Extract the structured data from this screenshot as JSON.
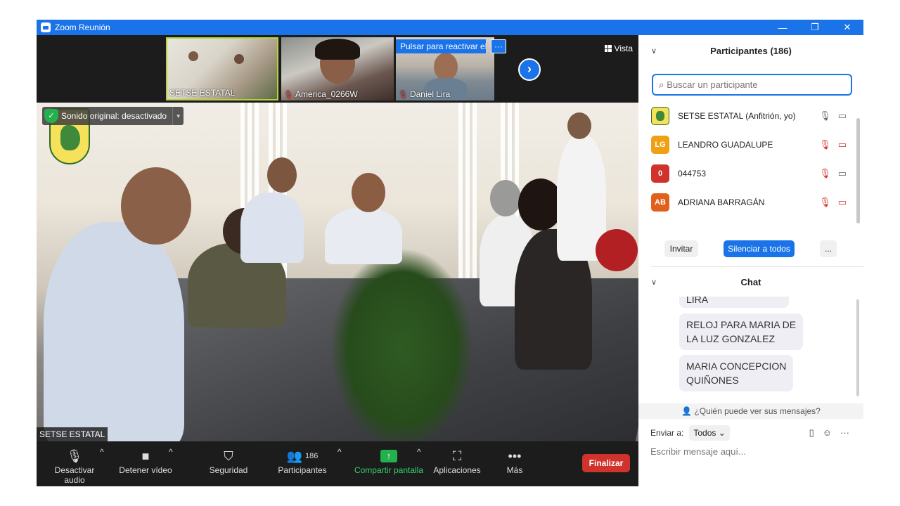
{
  "window": {
    "title": "Zoom Reunión",
    "minimize": "—",
    "restore": "❐",
    "close": "✕"
  },
  "strip": {
    "thumbs": [
      {
        "name": "SETSE ESTATAL"
      },
      {
        "name": "America_0266W"
      },
      {
        "name": "Daniel Lira"
      }
    ],
    "unmute_banner": "Pulsar para reactivar el audio",
    "banner_more": "···",
    "next_arrow": "›",
    "view_label": "Vista"
  },
  "main_video": {
    "sound_pill": "Sonido original: desactivado",
    "sound_dd": "▾",
    "name_tag": "SETSE ESTATAL"
  },
  "toolbar": {
    "mute": "Desactivar audio",
    "stop_video": "Detener vídeo",
    "security": "Seguridad",
    "participants": "Participantes",
    "participants_count": "186",
    "share": "Compartir pantalla",
    "apps": "Aplicaciones",
    "more": "Más",
    "end": "Finalizar",
    "caret": "^"
  },
  "participants_panel": {
    "title": "Participantes (186)",
    "search_placeholder": "Buscar un participante",
    "list": [
      {
        "initials": "",
        "name": "SETSE ESTATAL (Anfitrión, yo)",
        "color": "#f5e15a"
      },
      {
        "initials": "LG",
        "name": "LEANDRO GUADALUPE",
        "color": "#f0a015"
      },
      {
        "initials": "0",
        "name": "044753",
        "color": "#d0332c"
      },
      {
        "initials": "AB",
        "name": "ADRIANA BARRAGÁN",
        "color": "#e0601c"
      }
    ],
    "invite": "Invitar",
    "mute_all": "Silenciar a todos",
    "more": "..."
  },
  "chat": {
    "title": "Chat",
    "messages": [
      "LIRA",
      "RELOJ PARA MARIA DE\nLA LUZ GONZALEZ",
      "MARIA CONCEPCION\nQUIÑONES"
    ],
    "who_can_see": "¿Quién puede ver sus mensajes?",
    "send_to_label": "Enviar a:",
    "send_to_value": "Todos",
    "input_placeholder": "Escribir mensaje aquí..."
  }
}
